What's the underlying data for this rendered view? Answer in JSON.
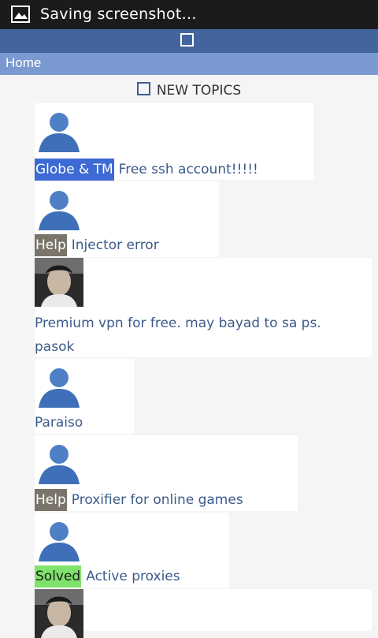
{
  "status_bar": {
    "text": "Saving screenshot..."
  },
  "breadcrumb": {
    "home": "Home"
  },
  "section": {
    "title": "NEW TOPICS"
  },
  "topics": [
    {
      "tag": "Globe & TM",
      "title": "Free ssh account!!!!!",
      "avatar": "default-avatar"
    },
    {
      "tag": "Help",
      "title": "Injector error",
      "avatar": "default-avatar"
    },
    {
      "title_line1": "Premium vpn for free. may bayad to sa ps.",
      "title_line2": "pasok",
      "avatar": "photo-avatar"
    },
    {
      "title": "Paraiso",
      "avatar": "default-avatar"
    },
    {
      "tag": "Help",
      "title": "Proxifier for online games",
      "avatar": "default-avatar"
    },
    {
      "tag": "Solved",
      "title": "Active proxies",
      "avatar": "default-avatar"
    },
    {
      "avatar": "photo-avatar"
    }
  ],
  "colors": {
    "header": "#42659e",
    "breadcrumb_bar": "#7a99d0",
    "tag_globe": "#3d6ad4",
    "tag_help": "#7a746a",
    "tag_solved": "#7fe26a"
  }
}
